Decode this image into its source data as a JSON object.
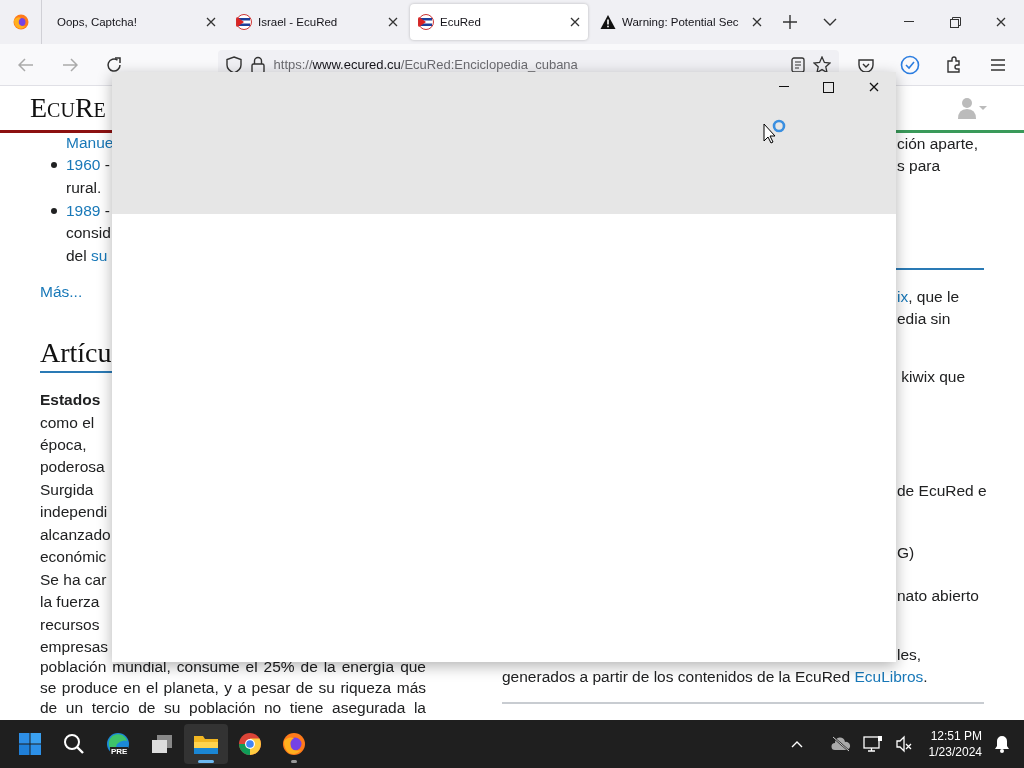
{
  "browser": {
    "tabs": [
      {
        "title": "Oops, Captcha!",
        "kind": "plain",
        "selected": false
      },
      {
        "title": "Israel - EcuRed",
        "kind": "site",
        "selected": false
      },
      {
        "title": "EcuRed",
        "kind": "site",
        "selected": true
      },
      {
        "title": "Warning: Potential Sec",
        "kind": "warning",
        "selected": false
      }
    ],
    "url": {
      "scheme": "https://",
      "host": "www.ecured.cu",
      "path": "/EcuRed:Enciclopedia_cubana"
    }
  },
  "page": {
    "logo": "EcuRe",
    "left": [
      {
        "kind": "indent",
        "parts": [
          {
            "text": "Manue",
            "link": true
          }
        ]
      },
      {
        "kind": "bullet",
        "parts": [
          {
            "text": "1960",
            "link": true
          },
          {
            "text": " -",
            "link": false
          }
        ]
      },
      {
        "kind": "indent",
        "parts": [
          {
            "text": "rural.",
            "link": false
          }
        ]
      },
      {
        "kind": "bullet",
        "parts": [
          {
            "text": "1989",
            "link": true
          },
          {
            "text": " -",
            "link": false
          }
        ]
      },
      {
        "kind": "indent",
        "parts": [
          {
            "text": "consid",
            "link": false
          }
        ]
      },
      {
        "kind": "indent",
        "parts": [
          {
            "text": "del ",
            "link": false
          },
          {
            "text": "su",
            "link": true
          }
        ]
      },
      {
        "kind": "para",
        "parts": [
          {
            "text": "Más...",
            "link": true
          }
        ]
      },
      {
        "kind": "heading",
        "parts": [
          {
            "text": "Artícu",
            "link": false
          }
        ]
      },
      {
        "kind": "bold",
        "parts": [
          {
            "text": "Estados",
            "link": false
          }
        ]
      },
      {
        "kind": "para",
        "parts": [
          {
            "text": "como el",
            "link": false
          }
        ]
      },
      {
        "kind": "para",
        "parts": [
          {
            "text": "época,",
            "link": false
          }
        ]
      },
      {
        "kind": "para",
        "parts": [
          {
            "text": "poderosa",
            "link": false
          }
        ]
      },
      {
        "kind": "para",
        "parts": [
          {
            "text": "Surgida",
            "link": false
          }
        ]
      },
      {
        "kind": "para",
        "parts": [
          {
            "text": "independi",
            "link": false
          }
        ]
      },
      {
        "kind": "para",
        "parts": [
          {
            "text": "alcanzado",
            "link": false
          }
        ]
      },
      {
        "kind": "para",
        "parts": [
          {
            "text": "económic",
            "link": false
          }
        ]
      },
      {
        "kind": "para",
        "parts": [
          {
            "text": "Se ha car",
            "link": false
          }
        ]
      },
      {
        "kind": "para",
        "parts": [
          {
            "text": "la fuerza",
            "link": false
          }
        ]
      },
      {
        "kind": "para",
        "parts": [
          {
            "text": "recursos",
            "link": false
          }
        ]
      },
      {
        "kind": "para",
        "parts": [
          {
            "text": "empresas",
            "link": false
          }
        ]
      },
      {
        "kind": "justify",
        "parts": [
          {
            "text": "población mundial, consume el 25% de la energía que",
            "link": false
          }
        ]
      },
      {
        "kind": "justify",
        "parts": [
          {
            "text": "se produce en el planeta, y a pesar de su riqueza más",
            "link": false
          }
        ]
      },
      {
        "kind": "justify",
        "parts": [
          {
            "text": "de un tercio de su población no tiene asegurada la",
            "link": false
          }
        ]
      }
    ],
    "right": [
      {
        "kind": "fragment",
        "parts": [
          {
            "text": "ción aparte,",
            "link": false
          }
        ]
      },
      {
        "kind": "fragment",
        "parts": [
          {
            "text": "s para",
            "link": false
          }
        ]
      },
      {
        "kind": "accent_rule"
      },
      {
        "kind": "fragment",
        "parts": [
          {
            "text": "ix",
            "link": true
          },
          {
            "text": ", que le",
            "link": false
          }
        ]
      },
      {
        "kind": "fragment",
        "parts": [
          {
            "text": "edia sin",
            "link": false
          }
        ]
      },
      {
        "kind": "fragment",
        "parts": [
          {
            "text": " kiwix que",
            "link": false
          }
        ]
      },
      {
        "kind": "fragment",
        "parts": [
          {
            "text": "de EcuRed e",
            "link": false
          }
        ]
      },
      {
        "kind": "fragment",
        "parts": [
          {
            "text": "G)",
            "link": false
          }
        ]
      },
      {
        "kind": "fragment",
        "parts": [
          {
            "text": "nato abierto",
            "link": false
          }
        ]
      },
      {
        "kind": "fragment",
        "parts": [
          {
            "text": "les,",
            "link": false
          }
        ]
      },
      {
        "kind": "full",
        "parts": [
          {
            "text": "generados a partir de los contenidos de la EcuRed ",
            "link": false
          },
          {
            "text": "EcuLibros",
            "link": true
          },
          {
            "text": ".",
            "link": false
          }
        ]
      },
      {
        "kind": "rule"
      }
    ]
  },
  "taskbar": {
    "apps": [
      {
        "kind": "start",
        "open": false,
        "selected": false
      },
      {
        "kind": "search",
        "open": false,
        "selected": false
      },
      {
        "kind": "edge",
        "badge": "PRE",
        "open": false,
        "selected": false
      },
      {
        "kind": "taskview",
        "open": false,
        "selected": false
      },
      {
        "kind": "explorer",
        "open": true,
        "selected": true
      },
      {
        "kind": "chrome",
        "open": false,
        "selected": false
      },
      {
        "kind": "firefox",
        "open": true,
        "selected": false
      }
    ],
    "time": "12:51 PM",
    "date": "1/23/2024"
  }
}
